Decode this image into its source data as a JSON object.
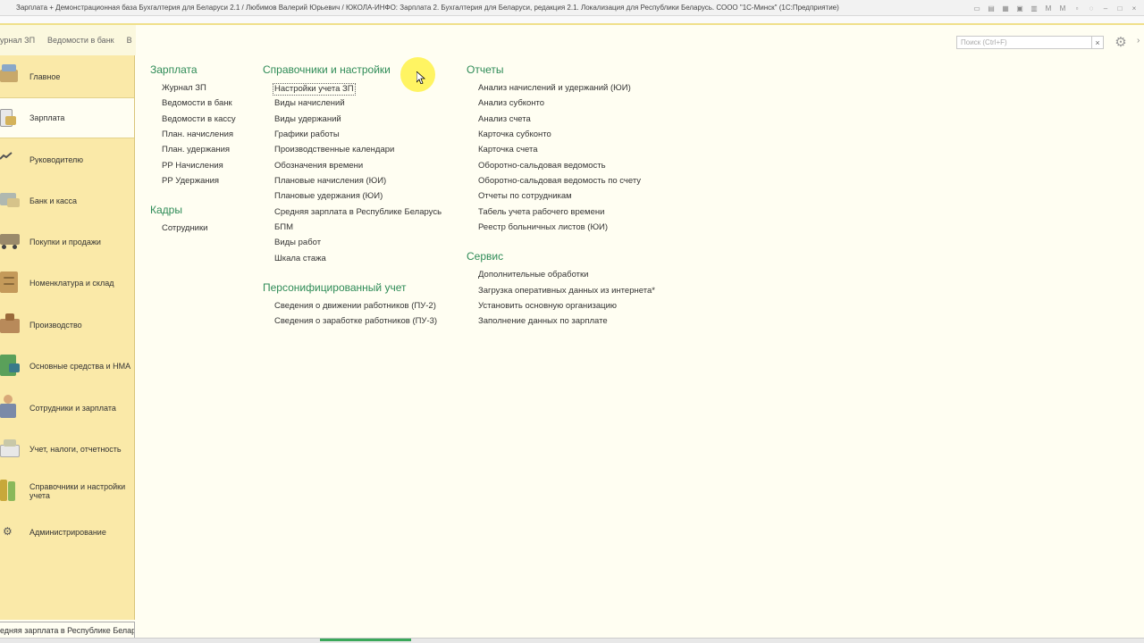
{
  "window": {
    "title": "Зарплата + Демонстрационная база Бухгалтерия для Беларуси 2.1 / Любимов Валерий Юрьевич / ЮКОЛА-ИНФО: Зарплата 2. Бухгалтерия для Беларуси, редакция 2.1. Локализация для Республики Беларусь. СООО \"1С-Минск\" (1С:Предприятие)"
  },
  "open_tabs": [
    "урнал ЗП",
    "Ведомости в банк",
    "В"
  ],
  "sidebar": {
    "items": [
      {
        "label": "Главное",
        "icon": "home-icon"
      },
      {
        "label": "Зарплата",
        "icon": "salary-icon",
        "active": true
      },
      {
        "label": "Руководителю",
        "icon": "chart-line-icon"
      },
      {
        "label": "Банк и касса",
        "icon": "bank-icon"
      },
      {
        "label": "Покупки и продажи",
        "icon": "truck-icon"
      },
      {
        "label": "Номенклатура и склад",
        "icon": "warehouse-icon"
      },
      {
        "label": "Производство",
        "icon": "production-icon"
      },
      {
        "label": "Основные средства и НМА",
        "icon": "assets-icon"
      },
      {
        "label": "Сотрудники и зарплата",
        "icon": "employee-icon"
      },
      {
        "label": "Учет, налоги, отчетность",
        "icon": "accounting-icon"
      },
      {
        "label": "Справочники и настройки учета",
        "icon": "books-icon"
      },
      {
        "label": "Администрирование",
        "icon": "gear-icon"
      }
    ]
  },
  "search": {
    "placeholder": "Поиск (Ctrl+F)",
    "clear": "×"
  },
  "status_left": "едняя зарплата в Республике Беларусь",
  "sections": {
    "salary": {
      "title": "Зарплата",
      "links": [
        "Журнал ЗП",
        "Ведомости в банк",
        "Ведомости в кассу",
        "План. начисления",
        "План. удержания",
        "РР Начисления",
        "РР Удержания"
      ]
    },
    "hr": {
      "title": "Кадры",
      "links": [
        "Сотрудники"
      ]
    },
    "refs": {
      "title": "Справочники и настройки",
      "links": [
        "Настройки учета ЗП",
        "Виды начислений",
        "Виды удержаний",
        "Графики работы",
        "Производственные календари",
        "Обозначения времени",
        "Плановые начисления (ЮИ)",
        "Плановые удержания (ЮИ)",
        "Средняя зарплата в Республике Беларусь",
        "БПМ",
        "Виды работ",
        "Шкала стажа"
      ]
    },
    "personal": {
      "title": "Персонифицированный учет",
      "links": [
        "Сведения о движении работников (ПУ-2)",
        "Сведения о заработке работников (ПУ-3)"
      ]
    },
    "reports": {
      "title": "Отчеты",
      "links": [
        "Анализ начислений и удержаний (ЮИ)",
        "Анализ субконто",
        "Анализ счета",
        "Карточка субконто",
        "Карточка счета",
        "Оборотно-сальдовая ведомость",
        "Оборотно-сальдовая ведомость по счету",
        "Отчеты по сотрудникам",
        "Табель учета рабочего времени",
        "Реестр больничных листов (ЮИ)"
      ]
    },
    "service": {
      "title": "Сервис",
      "links": [
        "Дополнительные обработки",
        "Загрузка оперативных данных из интернета*",
        "Установить основную организацию",
        "Заполнение данных по зарплате"
      ]
    }
  },
  "colors": {
    "accent": "#2e8b57",
    "sidebar_bg": "#fae9a8",
    "content_bg": "#fffef2",
    "highlight": "#fff35a"
  }
}
